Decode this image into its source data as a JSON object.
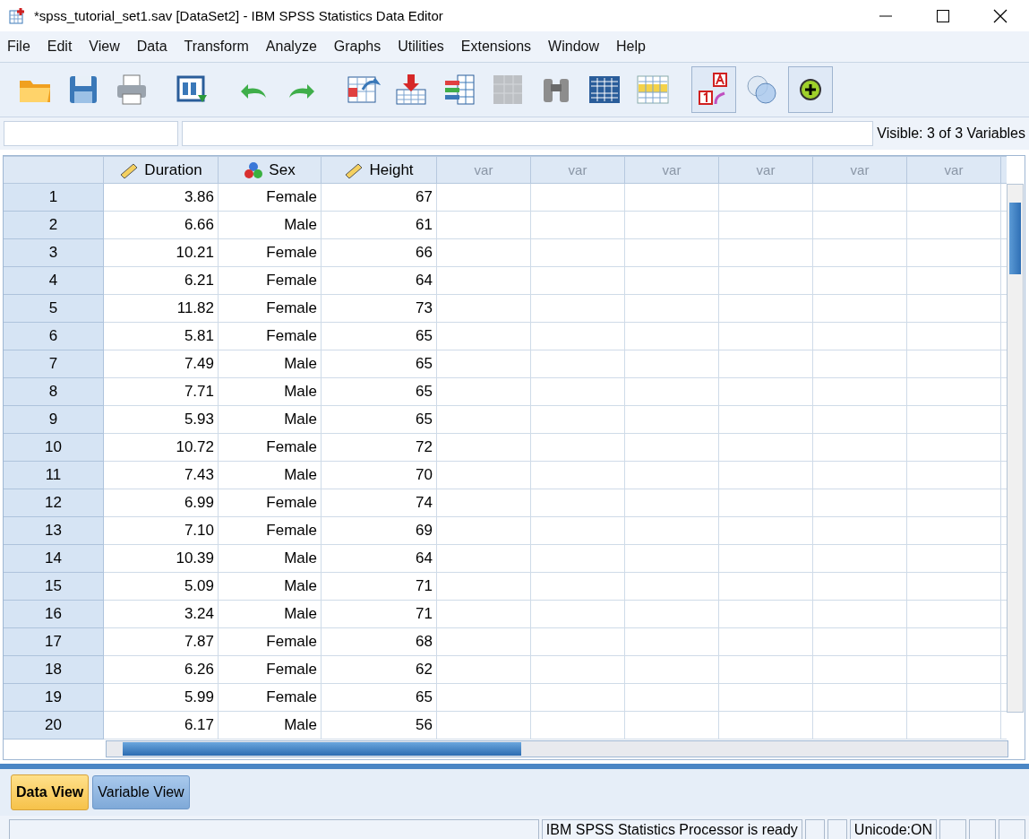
{
  "window": {
    "title": "*spss_tutorial_set1.sav [DataSet2] - IBM SPSS Statistics Data Editor"
  },
  "menu": [
    "File",
    "Edit",
    "View",
    "Data",
    "Transform",
    "Analyze",
    "Graphs",
    "Utilities",
    "Extensions",
    "Window",
    "Help"
  ],
  "toolbar": [
    {
      "kind": "open",
      "pressed": false,
      "disabled": false
    },
    {
      "kind": "save",
      "pressed": false,
      "disabled": false
    },
    {
      "kind": "print",
      "pressed": false,
      "disabled": false
    },
    {
      "kind": "dialog",
      "pressed": false,
      "disabled": false
    },
    {
      "kind": "undo",
      "pressed": false,
      "disabled": false
    },
    {
      "kind": "redo",
      "pressed": false,
      "disabled": false
    },
    {
      "kind": "gocase",
      "pressed": false,
      "disabled": false
    },
    {
      "kind": "govar",
      "pressed": false,
      "disabled": false
    },
    {
      "kind": "variables",
      "pressed": false,
      "disabled": false
    },
    {
      "kind": "stats",
      "pressed": false,
      "disabled": true
    },
    {
      "kind": "find",
      "pressed": false,
      "disabled": false
    },
    {
      "kind": "split",
      "pressed": false,
      "disabled": false
    },
    {
      "kind": "select",
      "pressed": false,
      "disabled": false
    },
    {
      "kind": "labels",
      "pressed": true,
      "disabled": false
    },
    {
      "kind": "sets",
      "pressed": false,
      "disabled": false
    },
    {
      "kind": "custom",
      "pressed": true,
      "disabled": false
    }
  ],
  "visible_label": "Visible: 3 of 3 Variables",
  "columns": [
    {
      "name": "Duration",
      "kind": "scale"
    },
    {
      "name": "Sex",
      "kind": "nominal"
    },
    {
      "name": "Height",
      "kind": "scale"
    },
    {
      "name": "var",
      "kind": "empty"
    },
    {
      "name": "var",
      "kind": "empty"
    },
    {
      "name": "var",
      "kind": "empty"
    },
    {
      "name": "var",
      "kind": "empty"
    },
    {
      "name": "var",
      "kind": "empty"
    },
    {
      "name": "var",
      "kind": "empty"
    }
  ],
  "rows": [
    {
      "n": "1",
      "cells": [
        "3.86",
        "Female",
        "67"
      ]
    },
    {
      "n": "2",
      "cells": [
        "6.66",
        "Male",
        "61"
      ]
    },
    {
      "n": "3",
      "cells": [
        "10.21",
        "Female",
        "66"
      ]
    },
    {
      "n": "4",
      "cells": [
        "6.21",
        "Female",
        "64"
      ]
    },
    {
      "n": "5",
      "cells": [
        "11.82",
        "Female",
        "73"
      ]
    },
    {
      "n": "6",
      "cells": [
        "5.81",
        "Female",
        "65"
      ]
    },
    {
      "n": "7",
      "cells": [
        "7.49",
        "Male",
        "65"
      ]
    },
    {
      "n": "8",
      "cells": [
        "7.71",
        "Male",
        "65"
      ]
    },
    {
      "n": "9",
      "cells": [
        "5.93",
        "Male",
        "65"
      ]
    },
    {
      "n": "10",
      "cells": [
        "10.72",
        "Female",
        "72"
      ]
    },
    {
      "n": "11",
      "cells": [
        "7.43",
        "Male",
        "70"
      ]
    },
    {
      "n": "12",
      "cells": [
        "6.99",
        "Female",
        "74"
      ]
    },
    {
      "n": "13",
      "cells": [
        "7.10",
        "Female",
        "69"
      ]
    },
    {
      "n": "14",
      "cells": [
        "10.39",
        "Male",
        "64"
      ]
    },
    {
      "n": "15",
      "cells": [
        "5.09",
        "Male",
        "71"
      ]
    },
    {
      "n": "16",
      "cells": [
        "3.24",
        "Male",
        "71"
      ]
    },
    {
      "n": "17",
      "cells": [
        "7.87",
        "Female",
        "68"
      ]
    },
    {
      "n": "18",
      "cells": [
        "6.26",
        "Female",
        "62"
      ]
    },
    {
      "n": "19",
      "cells": [
        "5.99",
        "Female",
        "65"
      ]
    },
    {
      "n": "20",
      "cells": [
        "6.17",
        "Male",
        "56"
      ]
    }
  ],
  "tabs": [
    {
      "label": "Data View",
      "selected": true
    },
    {
      "label": "Variable View",
      "selected": false
    }
  ],
  "status": [
    "IBM SPSS Statistics Processor is ready",
    "Unicode:ON"
  ]
}
